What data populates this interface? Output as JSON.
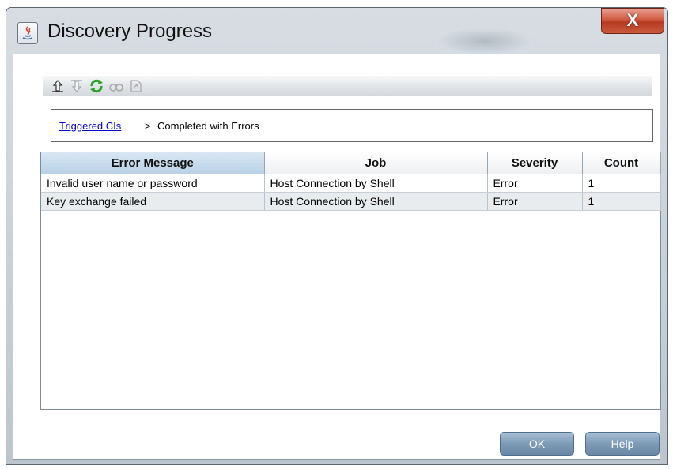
{
  "window": {
    "title": "Discovery Progress",
    "close_label": "X"
  },
  "toolbar": {
    "icons": [
      "move-up-icon",
      "move-down-icon",
      "refresh-icon",
      "find-icon",
      "export-icon"
    ]
  },
  "breadcrumb": {
    "link": "Triggered CIs",
    "separator": ">",
    "current": "Completed with Errors"
  },
  "table": {
    "columns": [
      "Error Message",
      "Job",
      "Severity",
      "Count"
    ],
    "rows": [
      [
        "Invalid user name or password",
        "Host Connection by Shell",
        "Error",
        "1"
      ],
      [
        "Key exchange failed",
        "Host Connection by Shell",
        "Error",
        "1"
      ]
    ]
  },
  "buttons": {
    "ok": "OK",
    "help": "Help"
  },
  "colors": {
    "link": "#0000cc",
    "sorted_header": "#b9d1e6",
    "button": "#7d9ab6",
    "close_button": "#c64a30"
  }
}
